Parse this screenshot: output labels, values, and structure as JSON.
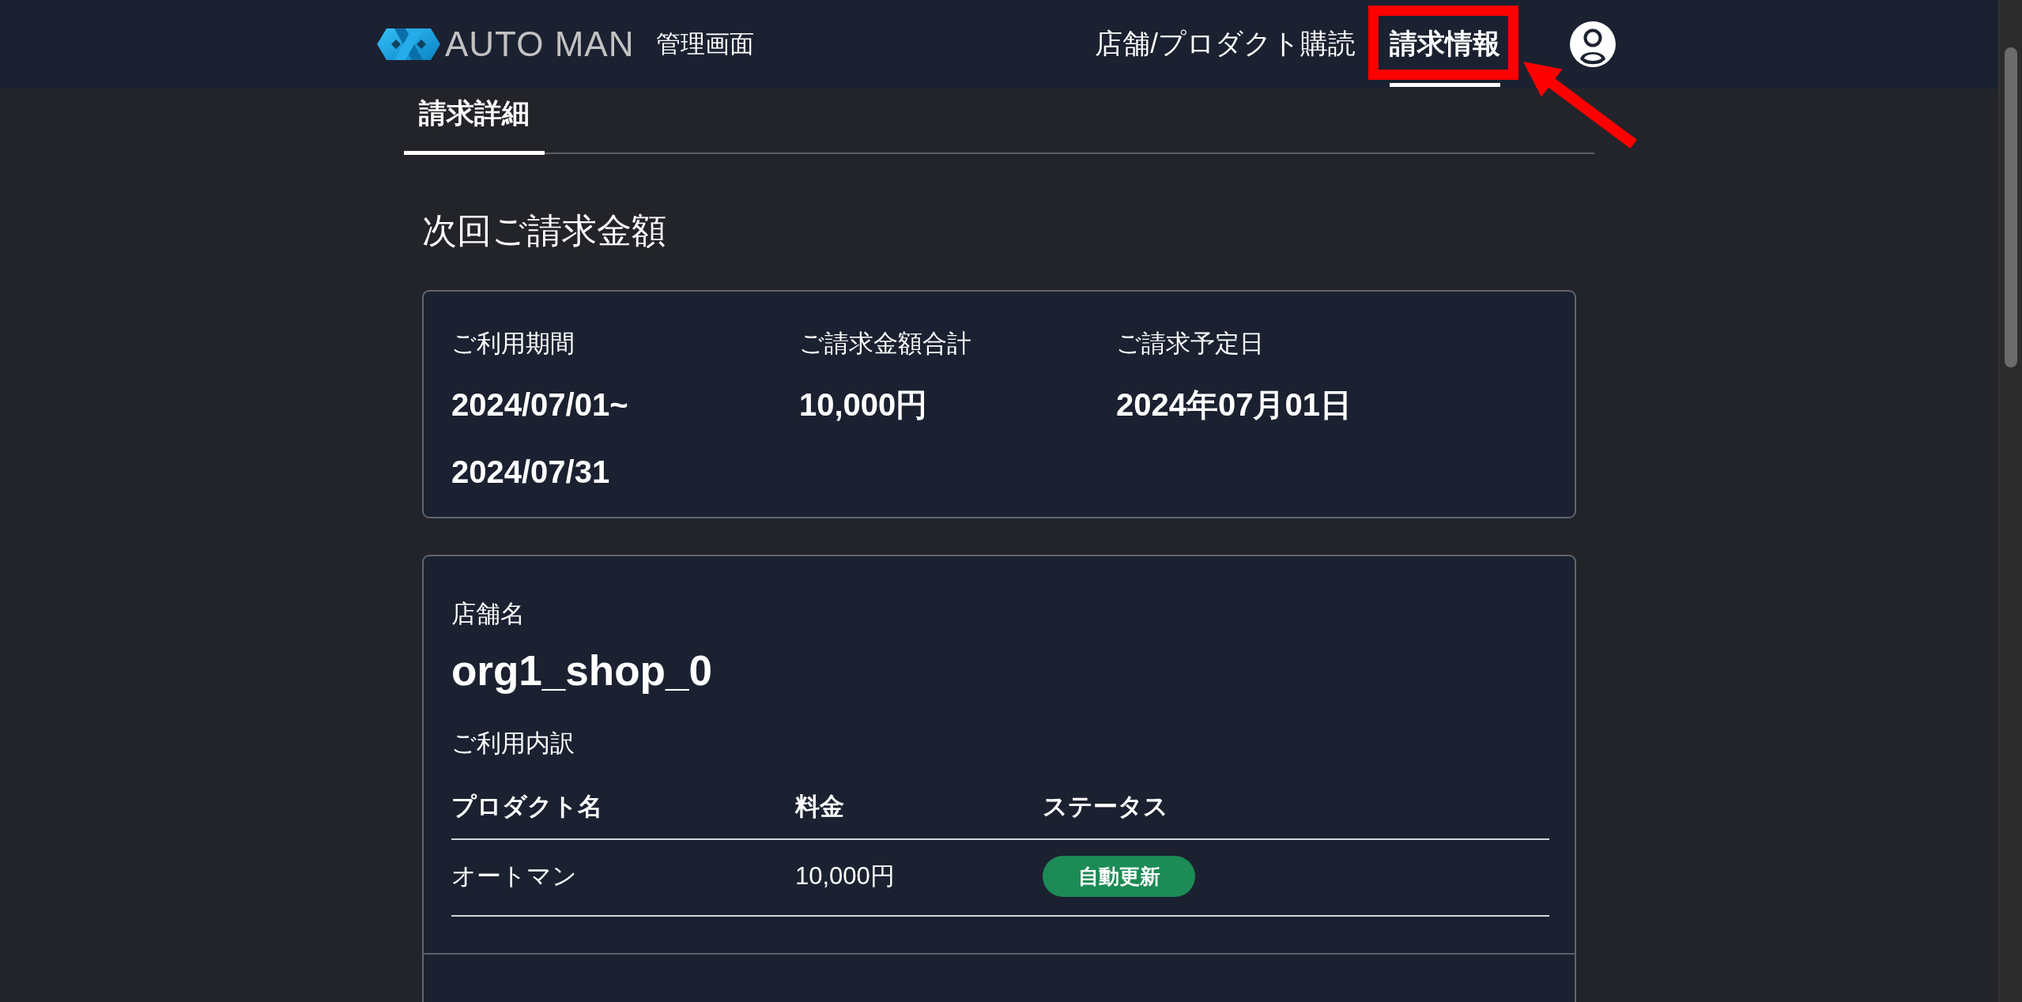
{
  "header": {
    "logo_text": "AUTO MAN",
    "subtitle": "管理画面",
    "nav": [
      {
        "label": "店舗/プロダクト購読",
        "selected": false,
        "highlighted": false
      },
      {
        "label": "請求情報",
        "selected": true,
        "highlighted": true
      }
    ]
  },
  "tabs": [
    {
      "label": "請求詳細",
      "selected": true
    }
  ],
  "section_title": "次回ご請求金額",
  "summary": [
    {
      "label": "ご利用期間",
      "value_lines": [
        "2024/07/01~",
        "2024/07/31"
      ]
    },
    {
      "label": "ご請求金額合計",
      "value_lines": [
        "10,000円"
      ]
    },
    {
      "label": "ご請求予定日",
      "value_lines": [
        "2024年07月01日"
      ]
    }
  ],
  "shops": [
    {
      "name_label": "店舗名",
      "name": "org1_shop_0",
      "usage_label": "ご利用内訳",
      "table": {
        "columns": [
          "プロダクト名",
          "料金",
          "ステータス"
        ],
        "rows": [
          {
            "product": "オートマン",
            "price": "10,000円",
            "status": {
              "label": "自動更新",
              "color": "#1d8b56"
            }
          }
        ]
      }
    }
  ]
}
